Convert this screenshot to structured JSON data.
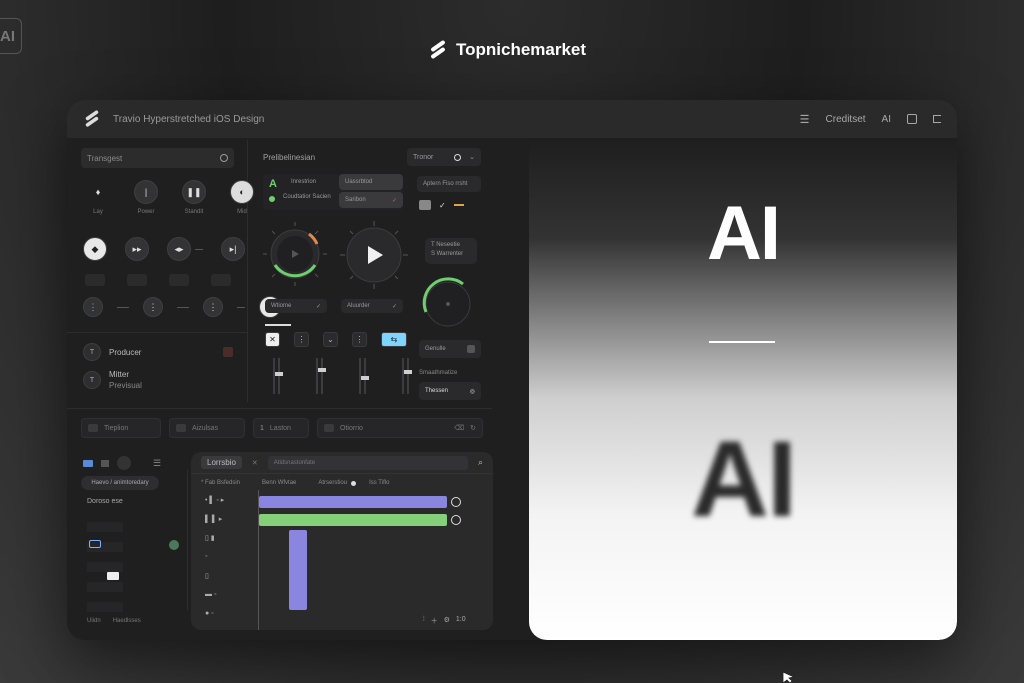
{
  "corner_badge": "AI",
  "brand": {
    "name": "Topnichemarket"
  },
  "window": {
    "title": "Travio Hyperstretched iOS Design",
    "toolbar": {
      "menu_label": "Creditset",
      "ai_label": "AI"
    }
  },
  "left": {
    "search_placeholder": "Transgest",
    "buttons_row1_labels": [
      "Lay",
      "Power",
      "Standit",
      "Mid"
    ],
    "list": [
      {
        "icon": "T",
        "label": "Producer"
      },
      {
        "icon": "T",
        "label": "Mitter",
        "sub": "Previsual"
      }
    ]
  },
  "middle": {
    "header": "Prelibelinesian",
    "dropdown": "Tronor",
    "info_rows": [
      "Inrestrion",
      "Coudtatior Sacien"
    ],
    "selected_rows": [
      "Uassrbtod",
      "Saribon"
    ],
    "right_button": "Aptern Fiso rrsht",
    "status_card": [
      "T Neseetie",
      "S Warrenter"
    ],
    "checks": [
      "Wtiome",
      "Aluurder"
    ],
    "cue_button": "Genulle",
    "side_label": "Smaathmatize",
    "side_value": "Thessen",
    "accent": {
      "green": "#6fcf6f",
      "orange": "#e0884a",
      "cyan": "#7fd3ff"
    }
  },
  "bottom_bar": {
    "fields": [
      "Tieplion",
      "Aizulsas",
      "Laston",
      "Otiorrio"
    ]
  },
  "sidebar_small": {
    "pill": "Haevo / animtoredary",
    "heading": "Doroso ese",
    "footer": [
      "Uiidn",
      "Haedlsses"
    ]
  },
  "timeline": {
    "title": "Lorrsbio",
    "search_placeholder": "Atidsnastonfate",
    "ruler": [
      "* Fab Bsfedsin",
      "Benn Wfvtae",
      "Atrserstiou",
      "Iss Tiflo"
    ],
    "footer_timestamp": "1:0"
  },
  "preview": {
    "headline": "AI",
    "blurred": "AI"
  }
}
